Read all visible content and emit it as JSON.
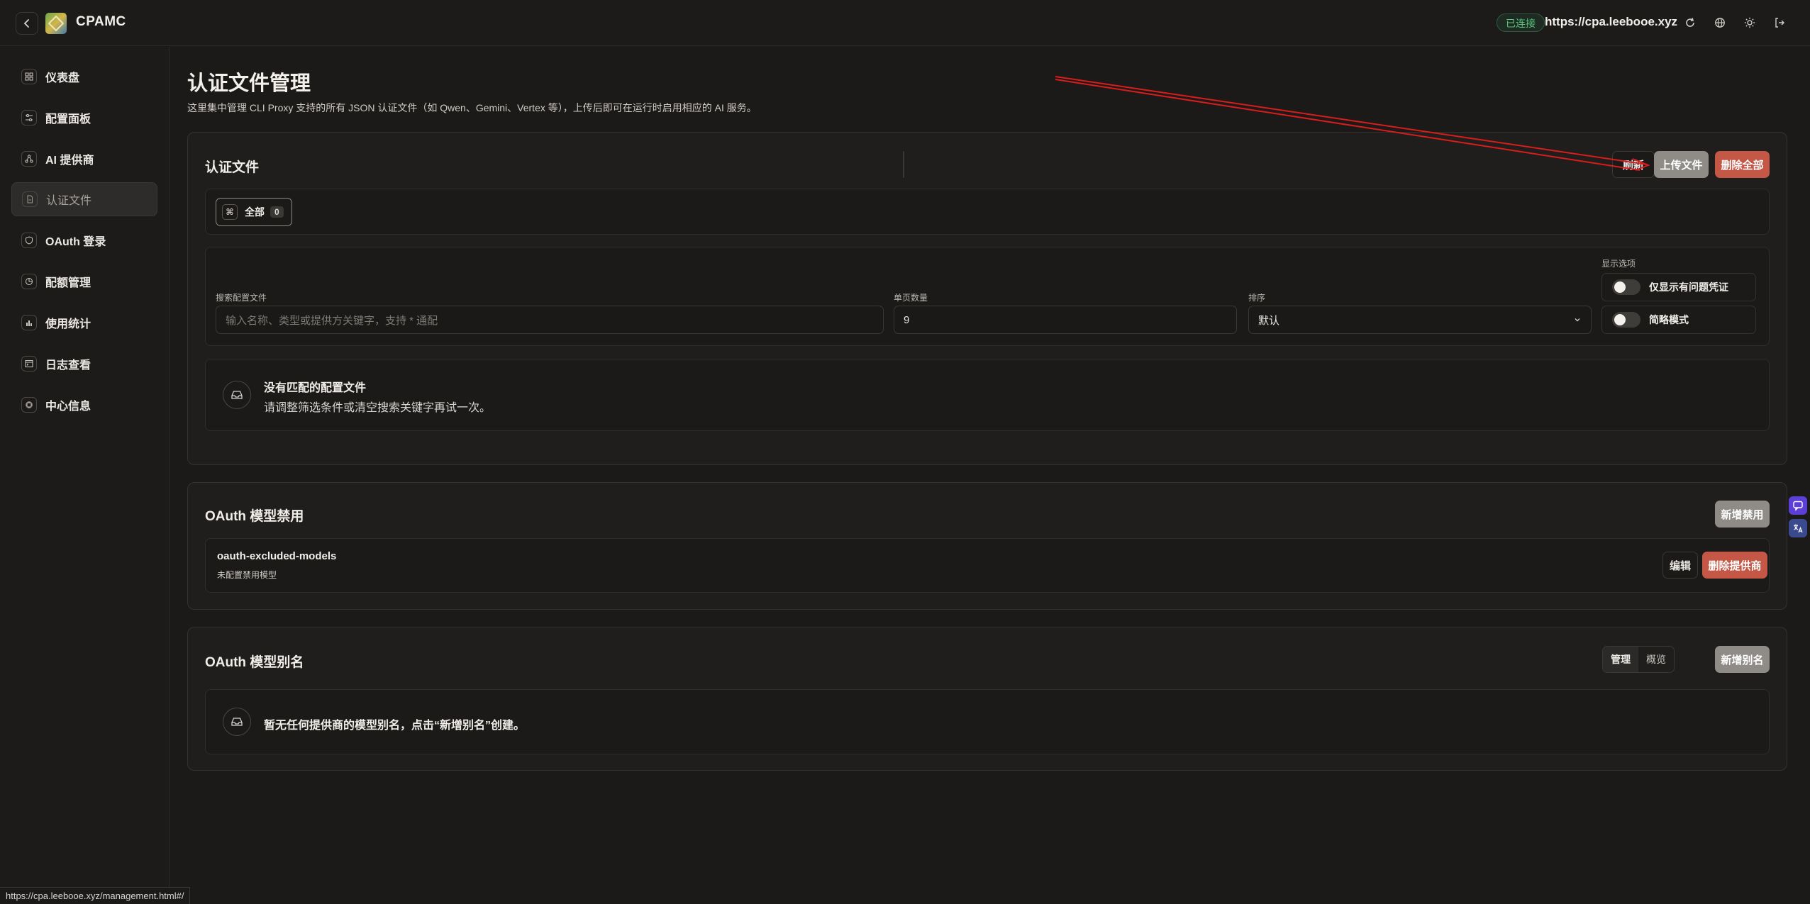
{
  "app": {
    "brand": "CPAMC",
    "status_badge": "已连接",
    "server_url": "https://cpa.leebooe.xyz",
    "icons": [
      "chevron-left-icon",
      "refresh-icon",
      "globe-icon",
      "sun-icon",
      "logout-icon"
    ]
  },
  "sidebar": {
    "items": [
      {
        "label": "仪表盘",
        "icon": "dashboard-icon"
      },
      {
        "label": "配置面板",
        "icon": "sliders-icon"
      },
      {
        "label": "AI 提供商",
        "icon": "network-icon"
      },
      {
        "label": "认证文件",
        "icon": "file-icon",
        "active": true
      },
      {
        "label": "OAuth 登录",
        "icon": "shield-icon"
      },
      {
        "label": "配额管理",
        "icon": "pie-icon"
      },
      {
        "label": "使用统计",
        "icon": "bar-chart-icon"
      },
      {
        "label": "日志查看",
        "icon": "terminal-icon"
      },
      {
        "label": "中心信息",
        "icon": "chip-icon"
      }
    ]
  },
  "page": {
    "title": "认证文件管理",
    "description": "这里集中管理 CLI Proxy 支持的所有 JSON 认证文件（如 Qwen、Gemini、Vertex 等），上传后即可在运行时启用相应的 AI 服务。"
  },
  "auth_files": {
    "title": "认证文件",
    "refresh_label": "刷新",
    "upload_label": "上传文件",
    "delete_all_label": "删除全部",
    "filter": {
      "label": "全部",
      "count": "0"
    },
    "search": {
      "label": "搜索配置文件",
      "placeholder": "输入名称、类型或提供方关键字，支持 * 通配"
    },
    "page_size": {
      "label": "单页数量",
      "value": "9"
    },
    "sort": {
      "label": "排序",
      "value": "默认"
    },
    "display_options": {
      "label": "显示选项",
      "problem_only": "仅显示有问题凭证",
      "compact_mode": "简略模式"
    },
    "empty": {
      "title": "没有匹配的配置文件",
      "description": "请调整筛选条件或清空搜索关键字再试一次。"
    }
  },
  "oauth_excluded": {
    "title": "OAuth 模型禁用",
    "add_label": "新增禁用",
    "row": {
      "name": "oauth-excluded-models",
      "subtitle": "未配置禁用模型"
    },
    "edit_label": "编辑",
    "delete_provider_label": "删除提供商"
  },
  "oauth_alias": {
    "title": "OAuth 模型别名",
    "manage_label": "管理",
    "overview_label": "概览",
    "add_label": "新增别名",
    "empty": "暂无任何提供商的模型别名，点击“新增别名”创建。"
  },
  "status_bar": {
    "url": "https://cpa.leebooe.xyz/management.html#/"
  },
  "colors": {
    "accent_red": "#c45746",
    "connected_green": "#58c77c",
    "annotation_arrow": "#d91d1d"
  }
}
